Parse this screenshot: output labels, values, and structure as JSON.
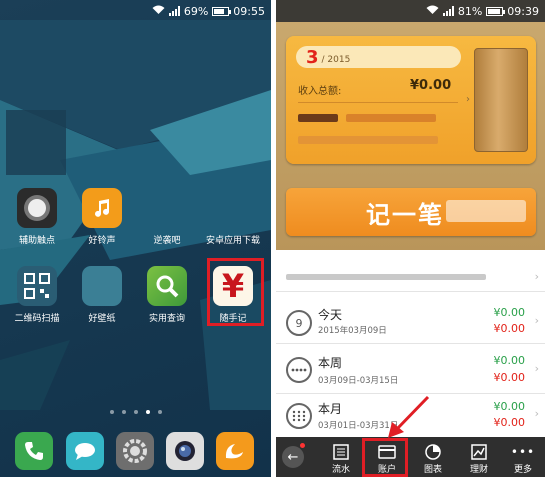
{
  "left_phone": {
    "status": {
      "battery": "69%",
      "time": "09:55"
    },
    "apps_row1": [
      {
        "label": "辅助触点",
        "icon": "circle-button-icon"
      },
      {
        "label": "好铃声",
        "icon": "music-note-icon"
      },
      {
        "label": "逆袭吧",
        "icon": "app-icon"
      },
      {
        "label": "安卓应用下载",
        "icon": "download-icon"
      }
    ],
    "apps_row2": [
      {
        "label": "二维码扫描",
        "icon": "qr-code-icon"
      },
      {
        "label": "好壁纸",
        "icon": "wallpaper-icon"
      },
      {
        "label": "实用查询",
        "icon": "magnifier-icon"
      },
      {
        "label": "随手记",
        "icon": "yen-icon"
      }
    ],
    "suishouji_glyph": "¥",
    "dock": [
      "phone-icon",
      "message-icon",
      "settings-icon",
      "camera-icon",
      "uc-browser-icon"
    ]
  },
  "right_phone": {
    "status": {
      "battery": "81%",
      "time": "09:39"
    },
    "card": {
      "month": "3",
      "year": "/ 2015",
      "income_label": "收入总额:",
      "income_value": "¥0.00"
    },
    "record_button": "记一笔",
    "rows": [
      {
        "title": "今天",
        "subtitle": "2015年03月09日",
        "income": "¥0.00",
        "expense": "¥0.00",
        "icon_text": "9"
      },
      {
        "title": "本周",
        "subtitle": "03月09日-03月15日",
        "income": "¥0.00",
        "expense": "¥0.00",
        "icon_text": ""
      },
      {
        "title": "本月",
        "subtitle": "03月01日-03月31日",
        "income": "¥0.00",
        "expense": "¥0.00",
        "icon_text": ""
      }
    ],
    "tabs": [
      {
        "label": "流水",
        "icon": "list-icon"
      },
      {
        "label": "账户",
        "icon": "card-icon"
      },
      {
        "label": "图表",
        "icon": "pie-chart-icon"
      },
      {
        "label": "理财",
        "icon": "trend-chart-icon"
      },
      {
        "label": "更多",
        "icon": "more-icon",
        "glyph": "•••"
      }
    ],
    "colors": {
      "highlight": "#e01e25",
      "income": "#2aa04a",
      "expense": "#e2231a",
      "card": "#f0a12a"
    }
  }
}
